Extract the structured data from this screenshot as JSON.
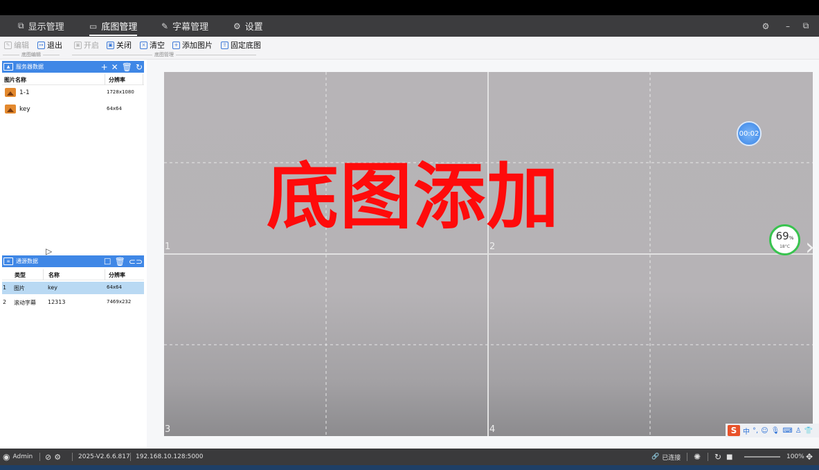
{
  "nav": {
    "tabs": [
      {
        "label": "显示管理",
        "icon": "copy-icon"
      },
      {
        "label": "底图管理",
        "icon": "edit-board-icon"
      },
      {
        "label": "字幕管理",
        "icon": "pen-icon"
      },
      {
        "label": "设置",
        "icon": "gear-icon"
      }
    ],
    "active_tab": "底图管理"
  },
  "toolbar": {
    "edit": "编辑",
    "exit": "退出",
    "open": "开启",
    "close": "关闭",
    "clear": "清空",
    "add_image": "添加图片",
    "fix_base": "固定底图",
    "group1_label": "底图编辑",
    "group2_label": "底图管理"
  },
  "server_panel": {
    "title": "服务器数据",
    "columns": [
      "图片名称",
      "分辨率"
    ],
    "rows": [
      {
        "name": "1-1",
        "resolution": "1728x1080"
      },
      {
        "name": "key",
        "resolution": "64x64"
      }
    ]
  },
  "source_panel": {
    "title": "通源数据",
    "columns": [
      "类型",
      "名称",
      "分辨率"
    ],
    "rows": [
      {
        "index": "1",
        "type": "图片",
        "name": "key",
        "resolution": "64x64",
        "selected": true
      },
      {
        "index": "2",
        "type": "滚动字幕",
        "name": "12313",
        "resolution": "7469x232",
        "selected": false
      }
    ]
  },
  "canvas": {
    "overlay_title": "底图添加",
    "regions": [
      "1",
      "2",
      "3",
      "4"
    ],
    "timer": "00:02",
    "cpu_percent": "69",
    "cpu_unit": "%",
    "temperature": "18°C"
  },
  "ime": {
    "mode": "中"
  },
  "status": {
    "user": "Admin",
    "version": "2025-V2.6.6.817",
    "address": "192.168.10.128:5000",
    "connection": "已连接",
    "zoom": "100%"
  },
  "colors": {
    "accent": "#3f87e6",
    "overlay_text": "#ff0b0b",
    "selected_row": "#b9d9f3"
  }
}
